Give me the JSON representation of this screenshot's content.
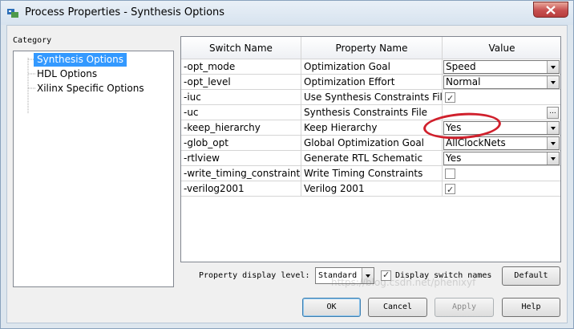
{
  "window": {
    "title": "Process Properties - Synthesis Options"
  },
  "category": {
    "label": "Category",
    "items": [
      "Synthesis Options",
      "HDL Options",
      "Xilinx Specific Options"
    ]
  },
  "grid": {
    "headers": [
      "Switch Name",
      "Property Name",
      "Value"
    ],
    "rows": [
      {
        "switch": "-opt_mode",
        "property": "Optimization Goal",
        "value": "Speed"
      },
      {
        "switch": "-opt_level",
        "property": "Optimization Effort",
        "value": "Normal"
      },
      {
        "switch": "-iuc",
        "property": "Use Synthesis Constraints File",
        "value": "checked"
      },
      {
        "switch": "-uc",
        "property": "Synthesis Constraints File",
        "value": "..."
      },
      {
        "switch": "-keep_hierarchy",
        "property": "Keep Hierarchy",
        "value": "Yes"
      },
      {
        "switch": "-glob_opt",
        "property": "Global Optimization Goal",
        "value": "AllClockNets"
      },
      {
        "switch": "-rtlview",
        "property": "Generate RTL Schematic",
        "value": "Yes"
      },
      {
        "switch": "-write_timing_constraints",
        "property": "Write Timing Constraints",
        "value": "unchecked"
      },
      {
        "switch": "-verilog2001",
        "property": "Verilog 2001",
        "value": "checked"
      }
    ]
  },
  "footer": {
    "display_level_label": "Property display level:",
    "display_level_value": "Standard",
    "display_switch_label": "Display switch names",
    "display_switch_checked": true,
    "default_label": "Default",
    "ok_label": "OK",
    "cancel_label": "Cancel",
    "apply_label": "Apply",
    "help_label": "Help"
  },
  "watermark": "https://blog.csdn.net/phenixyf",
  "colors": {
    "selection": "#3399ff",
    "annotation_circle": "#d0202c",
    "close_button": "#c75050"
  }
}
